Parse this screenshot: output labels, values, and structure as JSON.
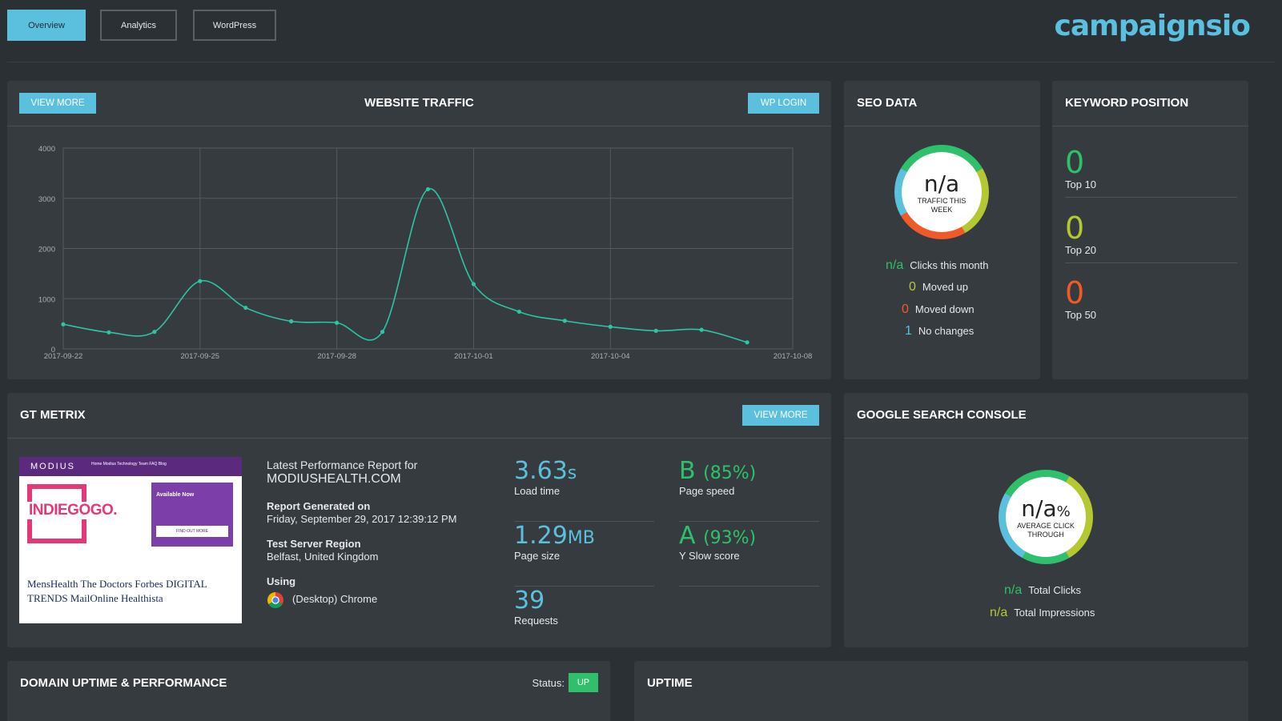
{
  "colors": {
    "accent": "#5bc0de",
    "green": "#2ec06a",
    "yellow": "#b5c832",
    "orange": "#f05a28",
    "panel": "#363b40",
    "background": "#2b3035"
  },
  "nav": {
    "tabs": [
      {
        "label": "Overview",
        "active": true
      },
      {
        "label": "Analytics",
        "active": false
      },
      {
        "label": "WordPress",
        "active": false
      }
    ],
    "brand": "campaignsio"
  },
  "traffic": {
    "title": "WEBSITE TRAFFIC",
    "view_more": "VIEW MORE",
    "wp_login": "WP LOGIN"
  },
  "chart_data": {
    "type": "line",
    "title": "WEBSITE TRAFFIC",
    "xlabel": "",
    "ylabel": "",
    "ylim": [
      0,
      4000
    ],
    "yticks": [
      0,
      1000,
      2000,
      3000,
      4000
    ],
    "xticks": [
      "2017-09-22",
      "2017-09-25",
      "2017-09-28",
      "2017-10-01",
      "2017-10-04",
      "2017-10-08"
    ],
    "xrange": [
      "2017-09-22",
      "2017-10-08"
    ],
    "grid": true,
    "series": [
      {
        "color": "#2ec4a6",
        "points": [
          {
            "x": "2017-09-22",
            "y": 490
          },
          {
            "x": "2017-09-23",
            "y": 330
          },
          {
            "x": "2017-09-24",
            "y": 340
          },
          {
            "x": "2017-09-25",
            "y": 1350
          },
          {
            "x": "2017-09-26",
            "y": 820
          },
          {
            "x": "2017-09-27",
            "y": 550
          },
          {
            "x": "2017-09-28",
            "y": 520
          },
          {
            "x": "2017-09-29",
            "y": 340
          },
          {
            "x": "2017-09-30",
            "y": 3180
          },
          {
            "x": "2017-10-01",
            "y": 1290
          },
          {
            "x": "2017-10-02",
            "y": 740
          },
          {
            "x": "2017-10-03",
            "y": 560
          },
          {
            "x": "2017-10-04",
            "y": 440
          },
          {
            "x": "2017-10-05",
            "y": 360
          },
          {
            "x": "2017-10-06",
            "y": 380
          },
          {
            "x": "2017-10-07",
            "y": 130
          }
        ]
      }
    ]
  },
  "seo": {
    "title": "SEO DATA",
    "ring_value": "n/a",
    "ring_label": "TRAFFIC THIS WEEK",
    "stats": [
      {
        "value": "n/a",
        "label": "Clicks this month",
        "color": "#2ec06a"
      },
      {
        "value": "0",
        "label": "Moved up",
        "color": "#b5c832"
      },
      {
        "value": "0",
        "label": "Moved down",
        "color": "#f05a28"
      },
      {
        "value": "1",
        "label": "No changes",
        "color": "#5bc0de"
      }
    ]
  },
  "keyword": {
    "title": "KEYWORD POSITION",
    "items": [
      {
        "value": "0",
        "label": "Top 10",
        "color": "#2ec06a"
      },
      {
        "value": "0",
        "label": "Top 20",
        "color": "#b5c832"
      },
      {
        "value": "0",
        "label": "Top 50",
        "color": "#f05a28"
      }
    ]
  },
  "gt": {
    "title": "GT METRIX",
    "view_more": "VIEW MORE",
    "report_title": "Latest Performance Report for",
    "domain": "MODIUSHEALTH.COM",
    "generated_label": "Report Generated on",
    "generated_value": "Friday, September 29, 2017 12:39:12 PM",
    "region_label": "Test Server Region",
    "region_value": "Belfast, United Kingdom",
    "using_label": "Using",
    "using_value": "(Desktop) Chrome",
    "thumb": {
      "logo": "MODIUS",
      "nav": "Home   Modius   Technology   Team   FAQ   Blog",
      "brand": "INDIEGOGO.",
      "box_title": "Available Now",
      "box_button": "FIND OUT MORE",
      "press": "MensHealth  The Doctors  Forbes   DIGITAL TRENDS  MailOnline  Healthista"
    },
    "metrics": [
      {
        "value": "3.63",
        "unit": "s",
        "label": "Load time"
      },
      {
        "value": "1.29",
        "unit": "MB",
        "label": "Page size"
      },
      {
        "value": "39",
        "unit": "",
        "label": "Requests"
      },
      {
        "value": "B",
        "pct": "(85%)",
        "label": "Page speed"
      },
      {
        "value": "A",
        "pct": "(93%)",
        "label": "Y Slow score"
      }
    ]
  },
  "gsc": {
    "title": "GOOGLE SEARCH CONSOLE",
    "ring_value": "n/a",
    "ring_unit": "%",
    "ring_label": "AVERAGE CLICK THROUGH",
    "stats": [
      {
        "value": "n/a",
        "label": "Total Clicks",
        "color": "#2ec06a"
      },
      {
        "value": "n/a",
        "label": "Total Impressions",
        "color": "#b5c832"
      }
    ]
  },
  "uptime_perf": {
    "title": "DOMAIN UPTIME & PERFORMANCE",
    "status_label": "Status:",
    "status_value": "UP"
  },
  "uptime": {
    "title": "UPTIME"
  }
}
